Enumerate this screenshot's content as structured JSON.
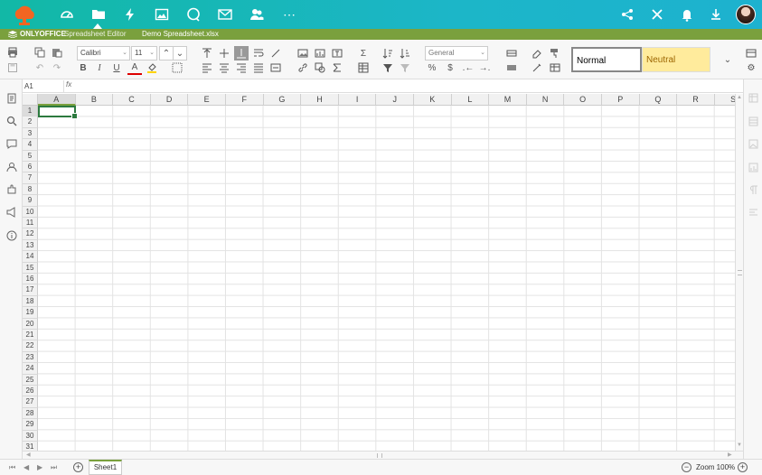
{
  "brand": {
    "name": "ONLYOFFICE",
    "editor": "Spreadsheet Editor",
    "document": "Demo Spreadsheet.xlsx"
  },
  "topnav": {
    "icons": [
      "dashboard-icon",
      "folder-icon",
      "activity-icon",
      "image-icon",
      "chat-icon",
      "mail-icon",
      "people-icon",
      "more-icon"
    ],
    "active": "folder-icon"
  },
  "topright": {
    "icons": [
      "share-icon",
      "close-icon",
      "bell-icon",
      "download-icon"
    ]
  },
  "toolbar": {
    "font_name": "Calibri",
    "font_size": "11",
    "number_format": "General",
    "bold": "B",
    "italic": "I",
    "underline": "U",
    "font_color": "A",
    "style_normal": "Normal",
    "style_neutral": "Neutral"
  },
  "formula": {
    "cell_ref": "A1",
    "fx": "fx",
    "value": ""
  },
  "columns": [
    "A",
    "B",
    "C",
    "D",
    "E",
    "F",
    "G",
    "H",
    "I",
    "J",
    "K",
    "L",
    "M",
    "N",
    "O",
    "P",
    "Q",
    "R",
    "S"
  ],
  "rows": [
    "1",
    "2",
    "3",
    "4",
    "5",
    "6",
    "7",
    "8",
    "9",
    "10",
    "11",
    "12",
    "13",
    "14",
    "15",
    "16",
    "17",
    "18",
    "19",
    "20",
    "21",
    "22",
    "23",
    "24",
    "25",
    "26",
    "27",
    "28",
    "29",
    "30",
    "31"
  ],
  "active_cell": {
    "col": "A",
    "row": "1"
  },
  "status": {
    "sheet": "Sheet1",
    "zoom": "Zoom 100%"
  },
  "colors": {
    "accent": "#7aa03d",
    "topbar": "#1cb6c8",
    "selection": "#2c7a3f",
    "neutral_bg": "#ffeb9c",
    "neutral_text": "#9c6500"
  }
}
